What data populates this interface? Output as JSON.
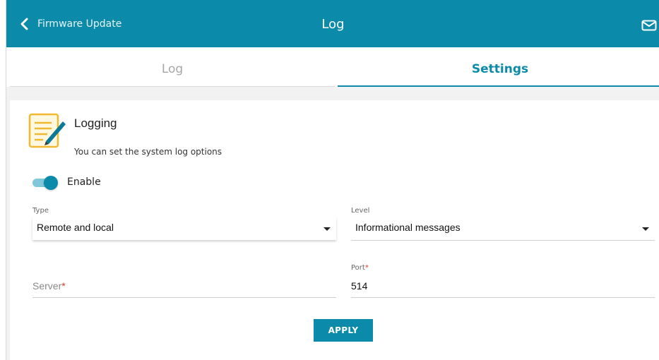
{
  "header": {
    "back_label": "Firmware Update",
    "title": "Log"
  },
  "tabs": [
    {
      "label": "Log",
      "active": false
    },
    {
      "label": "Settings",
      "active": true
    }
  ],
  "section": {
    "title": "Logging",
    "description": "You can set the system log options"
  },
  "enable": {
    "label": "Enable",
    "on": true
  },
  "type": {
    "label": "Type",
    "value": "Remote and local"
  },
  "level": {
    "label": "Level",
    "value": "Informational messages"
  },
  "server": {
    "placeholder": "Server",
    "required_mark": "*",
    "value": ""
  },
  "port": {
    "label": "Port",
    "required_mark": "*",
    "value": "514"
  },
  "apply_label": "APPLY",
  "colors": {
    "accent": "#0b8aa9",
    "required": "#d33b2c"
  }
}
